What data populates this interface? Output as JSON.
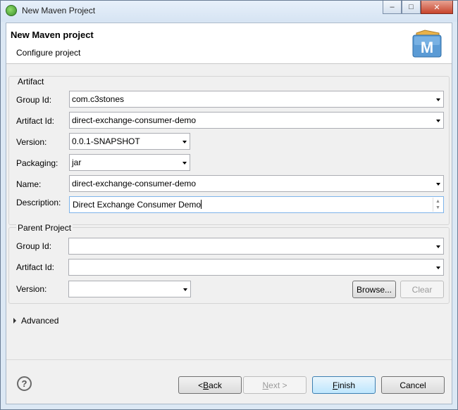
{
  "window": {
    "title": "New Maven Project",
    "controls": {
      "minimize": "‒",
      "maximize": "□",
      "close": "✕"
    }
  },
  "header": {
    "title": "New Maven project",
    "subtitle": "Configure project",
    "logo_letter": "M"
  },
  "artifact": {
    "group_title": "Artifact",
    "group_id": {
      "label": "Group Id:",
      "value": "com.c3stones"
    },
    "artifact_id": {
      "label": "Artifact Id:",
      "value": "direct-exchange-consumer-demo"
    },
    "version": {
      "label": "Version:",
      "value": "0.0.1-SNAPSHOT"
    },
    "packaging": {
      "label": "Packaging:",
      "value": "jar"
    },
    "name": {
      "label": "Name:",
      "value": "direct-exchange-consumer-demo"
    },
    "description": {
      "label": "Description:",
      "value": "Direct Exchange Consumer Demo"
    }
  },
  "parent": {
    "group_title": "Parent Project",
    "group_id": {
      "label": "Group Id:",
      "value": ""
    },
    "artifact_id": {
      "label": "Artifact Id:",
      "value": ""
    },
    "version": {
      "label": "Version:",
      "value": ""
    },
    "browse_label": "Browse...",
    "clear_label": "Clear"
  },
  "advanced": {
    "label": "Advanced"
  },
  "footer": {
    "help_glyph": "?",
    "back": {
      "prefix": "< ",
      "mnemonic": "B",
      "rest": "ack"
    },
    "next": {
      "mnemonic": "N",
      "rest": "ext >"
    },
    "finish": {
      "mnemonic": "F",
      "rest": "inish"
    },
    "cancel_label": "Cancel"
  }
}
